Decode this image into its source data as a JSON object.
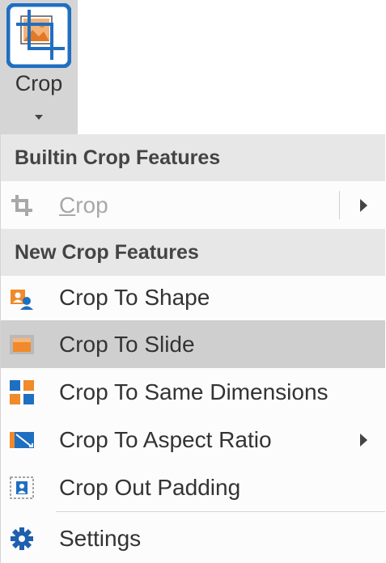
{
  "ribbon": {
    "crop_button": {
      "label": "Crop",
      "icon": "crop-picture-icon",
      "accent": "#1f6fc1"
    }
  },
  "menu": {
    "sections": [
      {
        "header": "Builtin Crop Features",
        "items": [
          {
            "label": "Crop",
            "accel_char": "C",
            "label_rest": "rop",
            "icon": "crop-icon",
            "enabled": false,
            "submenu": true
          }
        ]
      },
      {
        "header": "New Crop Features",
        "items": [
          {
            "label": "Crop To Shape",
            "icon": "crop-to-shape-icon",
            "enabled": true,
            "submenu": false
          },
          {
            "label": "Crop To Slide",
            "icon": "crop-to-slide-icon",
            "enabled": true,
            "submenu": false,
            "highlighted": true
          },
          {
            "label": "Crop To Same Dimensions",
            "icon": "crop-to-same-dimensions-icon",
            "enabled": true,
            "submenu": false
          },
          {
            "label": "Crop To Aspect Ratio",
            "icon": "crop-to-aspect-ratio-icon",
            "enabled": true,
            "submenu": true
          },
          {
            "label": "Crop Out Padding",
            "icon": "crop-out-padding-icon",
            "enabled": true,
            "submenu": false
          }
        ]
      }
    ],
    "footer_items": [
      {
        "label": "Settings",
        "icon": "gear-icon",
        "enabled": true
      }
    ]
  },
  "colors": {
    "orange": "#f08a2a",
    "blue": "#1f6fc1",
    "highlight": "#cfcfcf",
    "header_bg": "#e7e7e7"
  }
}
